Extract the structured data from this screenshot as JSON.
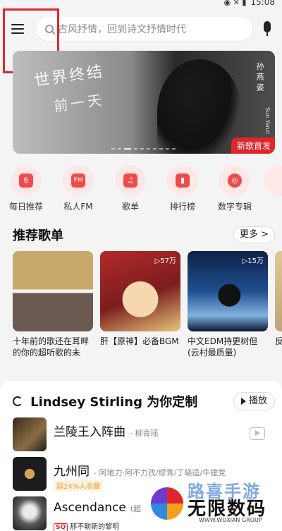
{
  "status": {
    "time": "15:08"
  },
  "search": {
    "placeholder": "古风抒情，回到诗文抒情时代"
  },
  "banner": {
    "script_line1": "世界终结",
    "script_line2": "前一天",
    "artist_cn": "孙燕姿",
    "artist_en": "Sun Yanzi",
    "tag": "新歌首发"
  },
  "quicknav": {
    "items": [
      {
        "label": "每日推荐",
        "icon": "calendar-icon",
        "glyph": "6"
      },
      {
        "label": "私人FM",
        "icon": "radio-icon",
        "glyph": "FM"
      },
      {
        "label": "歌单",
        "icon": "playlist-icon",
        "glyph": "♫"
      },
      {
        "label": "排行榜",
        "icon": "chart-icon",
        "glyph": "▮"
      },
      {
        "label": "数字专辑",
        "icon": "album-icon",
        "glyph": "◎"
      }
    ]
  },
  "recommend": {
    "title": "推荐歌单",
    "more": "更多 >",
    "playlists": [
      {
        "title": "十年前的歌还在耳畔的你的超听歌的未",
        "count": ""
      },
      {
        "title": "肝【原神】必备BGM",
        "count": "▷57万"
      },
      {
        "title": "中文EDM持更树但(云村最质量)",
        "count": "▷15万"
      },
      {
        "title": "反安",
        "count": ""
      }
    ]
  },
  "custom": {
    "title": "Lindsey Stirling 为你定制",
    "play": "播放",
    "songs": [
      {
        "name": "兰陵王入阵曲",
        "artist": "- 柳青瑶",
        "extra": ""
      },
      {
        "name": "九州同",
        "artist": "- 阿地力·阿不力孜/缪青/丁晓逵/牛建党",
        "extra": "超24%人收藏"
      },
      {
        "name": "Ascendance",
        "artist": "(超",
        "extra": "那不勒斯的黎明",
        "sq": "SQ"
      }
    ]
  },
  "watermark": {
    "cn_top": "路喜手游",
    "cn_main": "无限数码",
    "en": "WWW.WUXIAN GROUP"
  }
}
